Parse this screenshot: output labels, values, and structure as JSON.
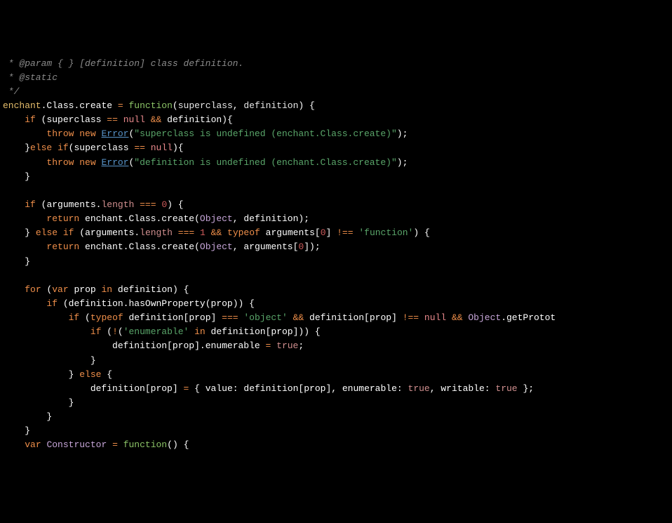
{
  "comment_line1": " * @param { } [definition] class definition.",
  "comment_line2": " * @static",
  "comment_line3": " */",
  "obj_enchant": "enchant",
  "prop_Class": "Class",
  "prop_create": "create",
  "op_assign": "=",
  "kw_function": "function",
  "param_superclass": "superclass",
  "param_definition": "definition",
  "kw_if": "if",
  "op_eqeq": "==",
  "lit_null": "null",
  "op_andand": "&&",
  "id_definition": "definition",
  "kw_throw": "throw",
  "kw_new": "new",
  "type_Error": "Error",
  "str_superclass_undef": "\"superclass is undefined (enchant.Class.create)\"",
  "kw_else": "else",
  "str_definition_undef": "\"definition is undefined (enchant.Class.create)\"",
  "id_arguments": "arguments",
  "prop_length": "length",
  "op_tripleeq": "===",
  "num_0": "0",
  "kw_return": "return",
  "builtin_Object": "Object",
  "num_1": "1",
  "kw_typeof": "typeof",
  "op_noteq": "!==",
  "str_function": "'function'",
  "kw_for": "for",
  "kw_var": "var",
  "id_prop": "prop",
  "kw_in": "in",
  "method_hasOwnProperty": "hasOwnProperty",
  "str_object": "'object'",
  "method_getPrototype": "getProtot",
  "op_not": "!",
  "str_enumerable": "'enumerable'",
  "prop_enumerable": "enumerable",
  "bool_true": "true",
  "prop_value": "value",
  "prop_writable": "writable",
  "id_Constructor": "Constructor",
  "brace_open": "{",
  "brace_close": "}",
  "paren_open": "(",
  "paren_close": ")",
  "bracket_open": "[",
  "bracket_close": "]",
  "semicolon": ";",
  "comma": ",",
  "dot": ".",
  "colon": ":"
}
